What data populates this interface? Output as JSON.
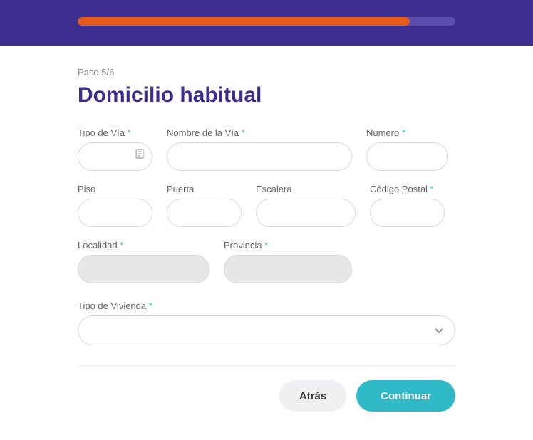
{
  "progress": {
    "percent": 88
  },
  "step": {
    "label": "Paso 5/6"
  },
  "title": "Domicilio habitual",
  "fields": {
    "tipoVia": {
      "label": "Tipo de Vía",
      "required": true,
      "value": ""
    },
    "nombreVia": {
      "label": "Nombre de la Vía",
      "required": true,
      "value": ""
    },
    "numero": {
      "label": "Numero",
      "required": true,
      "value": ""
    },
    "piso": {
      "label": "Piso",
      "required": false,
      "value": ""
    },
    "puerta": {
      "label": "Puerta",
      "required": false,
      "value": ""
    },
    "escalera": {
      "label": "Escalera",
      "required": false,
      "value": ""
    },
    "codigoPostal": {
      "label": "Código Postal",
      "required": true,
      "value": ""
    },
    "localidad": {
      "label": "Localidad",
      "required": true,
      "value": "",
      "disabled": true
    },
    "provincia": {
      "label": "Provincia",
      "required": true,
      "value": "",
      "disabled": true
    },
    "tipoVivienda": {
      "label": "Tipo de Vivienda",
      "required": true,
      "value": ""
    }
  },
  "buttons": {
    "back": "Atrás",
    "next": "Continuar"
  },
  "requiredMark": " *"
}
